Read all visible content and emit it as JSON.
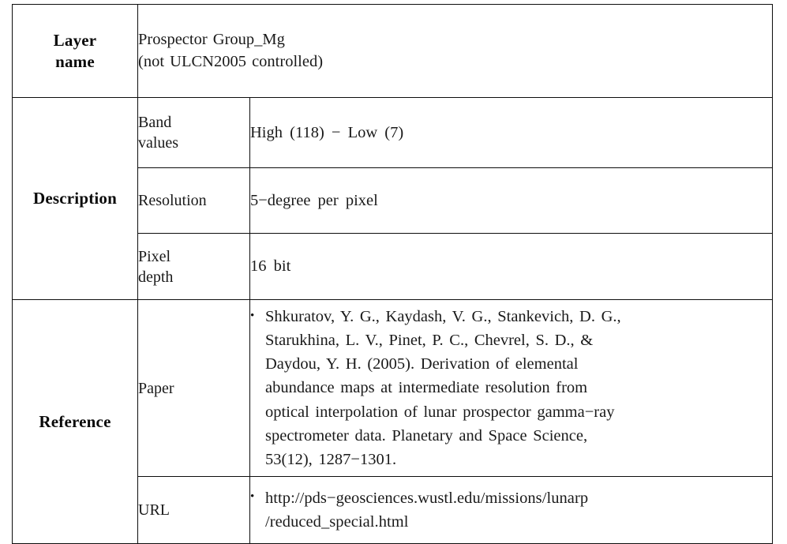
{
  "table": {
    "rows": {
      "layer_name": {
        "category": "Layer name",
        "category_line1": "Layer",
        "category_line2": "name",
        "value_line1": "Prospector Group_Mg",
        "value_line2": "(not ULCN2005 controlled)"
      },
      "description": {
        "category": "Description",
        "band_values": {
          "label_line1": "Band",
          "label_line2": "values",
          "value": "High (118) − Low (7)"
        },
        "resolution": {
          "label": "Resolution",
          "value": "5−degree per pixel"
        },
        "pixel_depth": {
          "label_line1": "Pixel",
          "label_line2": "depth",
          "value": "16 bit"
        }
      },
      "reference": {
        "category": "Reference",
        "paper": {
          "label": "Paper",
          "bullet": "•",
          "line1": "Shkuratov, Y. G., Kaydash, V. G., Stankevich, D. G.,",
          "line2": "Starukhina, L. V., Pinet, P. C., Chevrel, S. D., &",
          "line3": "Daydou, Y. H. (2005). Derivation of elemental",
          "line4": "abundance maps at intermediate resolution from",
          "line5": "optical interpolation of lunar prospector gamma−ray",
          "line6": "spectrometer data. Planetary and Space Science,",
          "line7": "53(12), 1287−1301."
        },
        "url": {
          "label": "URL",
          "bullet": "•",
          "line1": "http://pds−geosciences.wustl.edu/missions/lunarp",
          "line2": "/reduced_special.html"
        }
      }
    }
  },
  "colors": {
    "border": "#0d0d0d",
    "text": "#1a1a1a",
    "heading_text": "#0a0a0a",
    "background": "#ffffff"
  }
}
